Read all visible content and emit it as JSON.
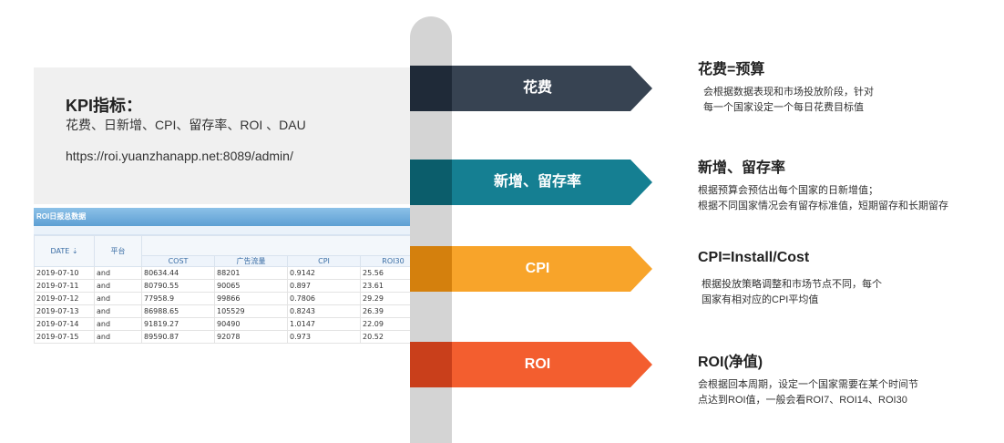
{
  "kpi": {
    "title": "KPI指标：",
    "items": "花费、日新增、CPI、留存率、ROI 、DAU",
    "url": "https://roi.yuanzhanapp.net:8089/admin/"
  },
  "table": {
    "caption": "ROI日报总数据",
    "headers": {
      "date": "DATE ⇣",
      "platform": "平台",
      "cost": "COST",
      "traffic": "广告流量",
      "cpi": "CPI",
      "roi30": "ROI30"
    },
    "rows": [
      [
        "2019-07-10",
        "and",
        "80634.44",
        "88201",
        "0.9142",
        "25.56"
      ],
      [
        "2019-07-11",
        "and",
        "80790.55",
        "90065",
        "0.897",
        "23.61"
      ],
      [
        "2019-07-12",
        "and",
        "77958.9",
        "99866",
        "0.7806",
        "29.29"
      ],
      [
        "2019-07-13",
        "and",
        "86988.65",
        "105529",
        "0.8243",
        "26.39"
      ],
      [
        "2019-07-14",
        "and",
        "91819.27",
        "90490",
        "1.0147",
        "22.09"
      ],
      [
        "2019-07-15",
        "and",
        "89590.87",
        "92078",
        "0.973",
        "20.52"
      ]
    ]
  },
  "arrows": [
    {
      "label": "花费",
      "color": "#374352"
    },
    {
      "label": "新增、留存率",
      "color": "#157f92"
    },
    {
      "label": "CPI",
      "color": "#f8a42a"
    },
    {
      "label": "ROI",
      "color": "#f35e2f"
    }
  ],
  "descriptions": [
    {
      "title": "花费=预算",
      "lines": [
        "会根据数据表现和市场投放阶段，针对",
        "每一个国家设定一个每日花费目标值"
      ]
    },
    {
      "title": "新增、留存率",
      "lines": [
        "根据预算会预估出每个国家的日新增值；",
        "根据不同国家情况会有留存标准值，短期留存和长期留存"
      ]
    },
    {
      "title": "CPI=Install/Cost",
      "lines": [
        "根据投放策略调整和市场节点不同，每个",
        "国家有相对应的CPI平均值"
      ]
    },
    {
      "title": "ROI(净值)",
      "lines": [
        "会根据回本周期，设定一个国家需要在某个时间节",
        "点达到ROI值，一般会看ROI7、ROI14、ROI30"
      ]
    }
  ]
}
